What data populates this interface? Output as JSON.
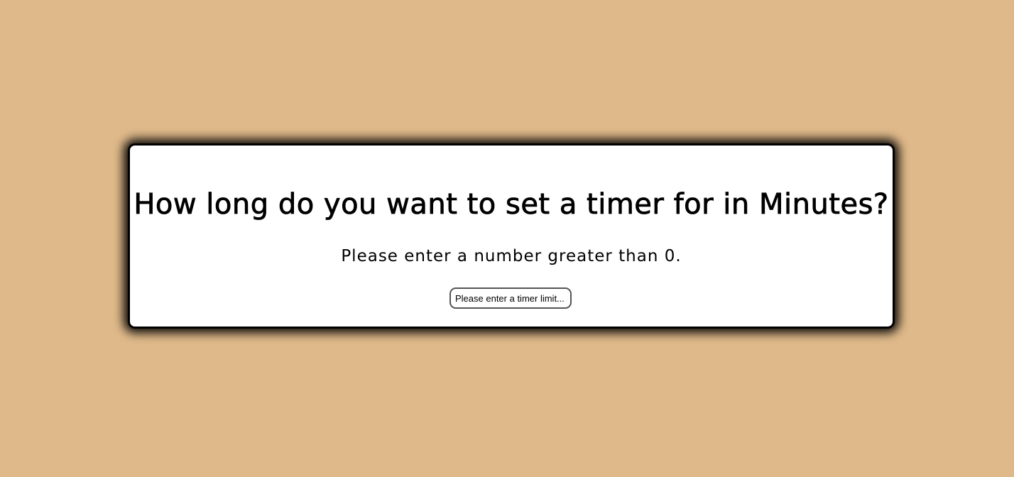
{
  "prompt": {
    "title": "How long do you want to set a timer for in Minutes?",
    "subtitle": "Please enter a number greater than 0."
  },
  "timer_input": {
    "value": "",
    "placeholder": "Please enter a timer limit..."
  },
  "colors": {
    "background": "#dfb98a",
    "card": "#ffffff",
    "card_border": "#000000",
    "text": "#000000"
  }
}
